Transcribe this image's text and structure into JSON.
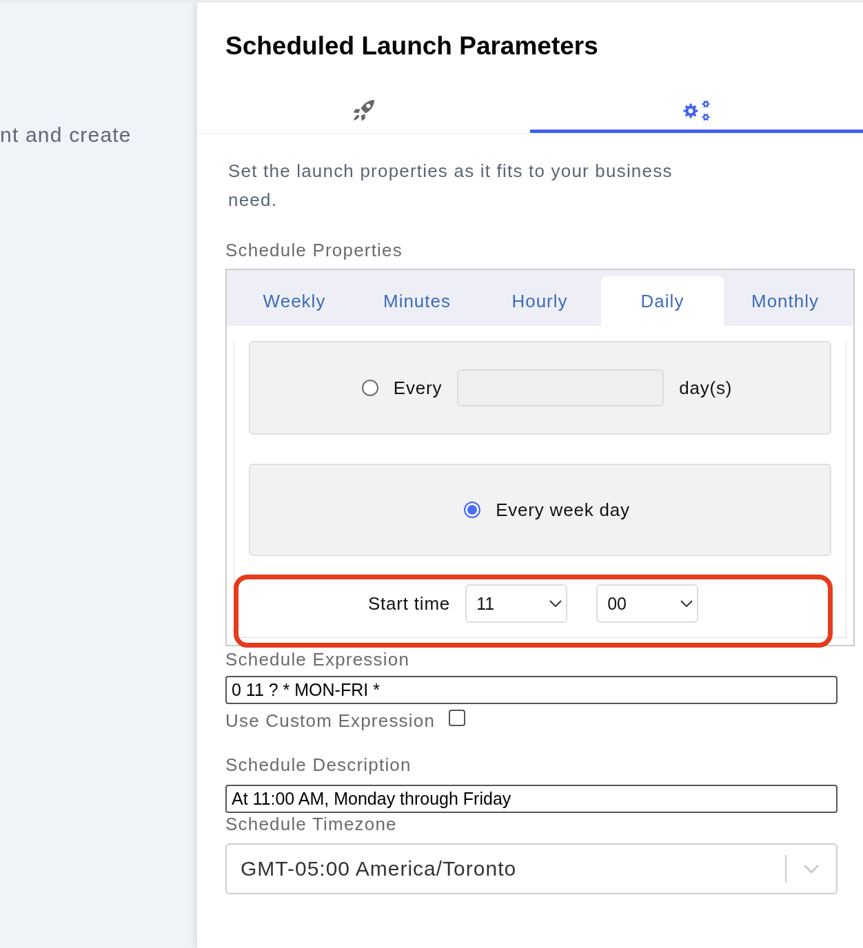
{
  "background_page": {
    "text": "nt and create"
  },
  "panel": {
    "title": "Scheduled Launch Parameters",
    "tabs": [
      {
        "selected": false
      },
      {
        "selected": true
      }
    ],
    "intro": "Set the launch properties as it fits to your business need."
  },
  "schedule_properties": {
    "label": "Schedule Properties",
    "tabs": [
      {
        "label": "Weekly",
        "selected": false
      },
      {
        "label": "Minutes",
        "selected": false
      },
      {
        "label": "Hourly",
        "selected": false
      },
      {
        "label": "Daily",
        "selected": true
      },
      {
        "label": "Monthly",
        "selected": false
      }
    ],
    "daily": {
      "options": [
        {
          "kind": "interval",
          "label": "Every",
          "unit": "day(s)",
          "selected": false
        },
        {
          "kind": "weekday",
          "label": "Every week day",
          "selected": true
        }
      ],
      "start_time": {
        "label": "Start time",
        "hour": "11",
        "minute": "00",
        "highlighted": true
      }
    }
  },
  "schedule_expression": {
    "label": "Schedule Expression",
    "value": "0 11 ? * MON-FRI *"
  },
  "custom_expression": {
    "label": "Use Custom Expression",
    "checked": false
  },
  "schedule_description": {
    "label": "Schedule Description",
    "value": "At 11:00 AM, Monday through Friday"
  },
  "schedule_timezone": {
    "label": "Schedule Timezone",
    "value": "GMT-05:00 America/Toronto"
  }
}
